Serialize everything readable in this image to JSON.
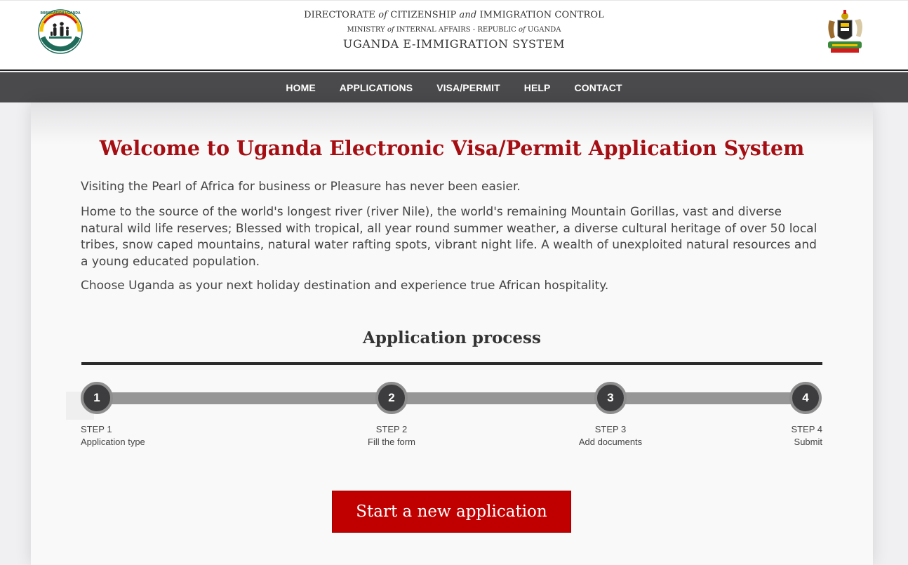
{
  "header": {
    "line1_a": "DIRECTORATE ",
    "line1_of": "of",
    "line1_b": " CITIZENSHIP ",
    "line1_and": "and",
    "line1_c": " IMMIGRATION CONTROL",
    "line2_a": "MINISTRY ",
    "line2_of1": "of",
    "line2_b": " INTERNAL AFFAIRS - REPUBLIC ",
    "line2_of2": "of",
    "line2_c": " UGANDA",
    "system_name": "UGANDA E-IMMIGRATION SYSTEM",
    "logo_left_text": "IMMIGRATION UGANDA",
    "logo_left_icon": "immigration-uganda-logo-icon",
    "logo_right_icon": "uganda-coat-of-arms-icon"
  },
  "nav": {
    "items": [
      "HOME",
      "APPLICATIONS",
      "VISA/PERMIT",
      "HELP",
      "CONTACT"
    ]
  },
  "main": {
    "welcome_title": "Welcome to Uganda Electronic Visa/Permit Application System",
    "para1": "Visiting the Pearl of Africa for business or Pleasure has never been easier.",
    "para2": "Home to the source of the world's longest river (river Nile), the world's remaining Mountain Gorillas, vast and diverse natural wild life reserves; Blessed with tropical, all year round summer weather, a diverse cultural heritage of over 50 local tribes, snow caped mountains, natural water rafting spots, vibrant night life. A wealth of unexploited natural resources and a young educated population.",
    "para3": "Choose Uganda as your next holiday destination and experience true African hospitality.",
    "process_title": "Application process",
    "steps": [
      {
        "number": "1",
        "step": "STEP 1",
        "label": "Application type"
      },
      {
        "number": "2",
        "step": "STEP 2",
        "label": "Fill the form"
      },
      {
        "number": "3",
        "step": "STEP 3",
        "label": "Add documents"
      },
      {
        "number": "4",
        "step": "STEP 4",
        "label": "Submit"
      }
    ],
    "start_button": "Start a new application"
  },
  "colors": {
    "accent_red": "#c00000",
    "title_red": "#a50e12",
    "nav_bg": "#4a4a4c"
  }
}
